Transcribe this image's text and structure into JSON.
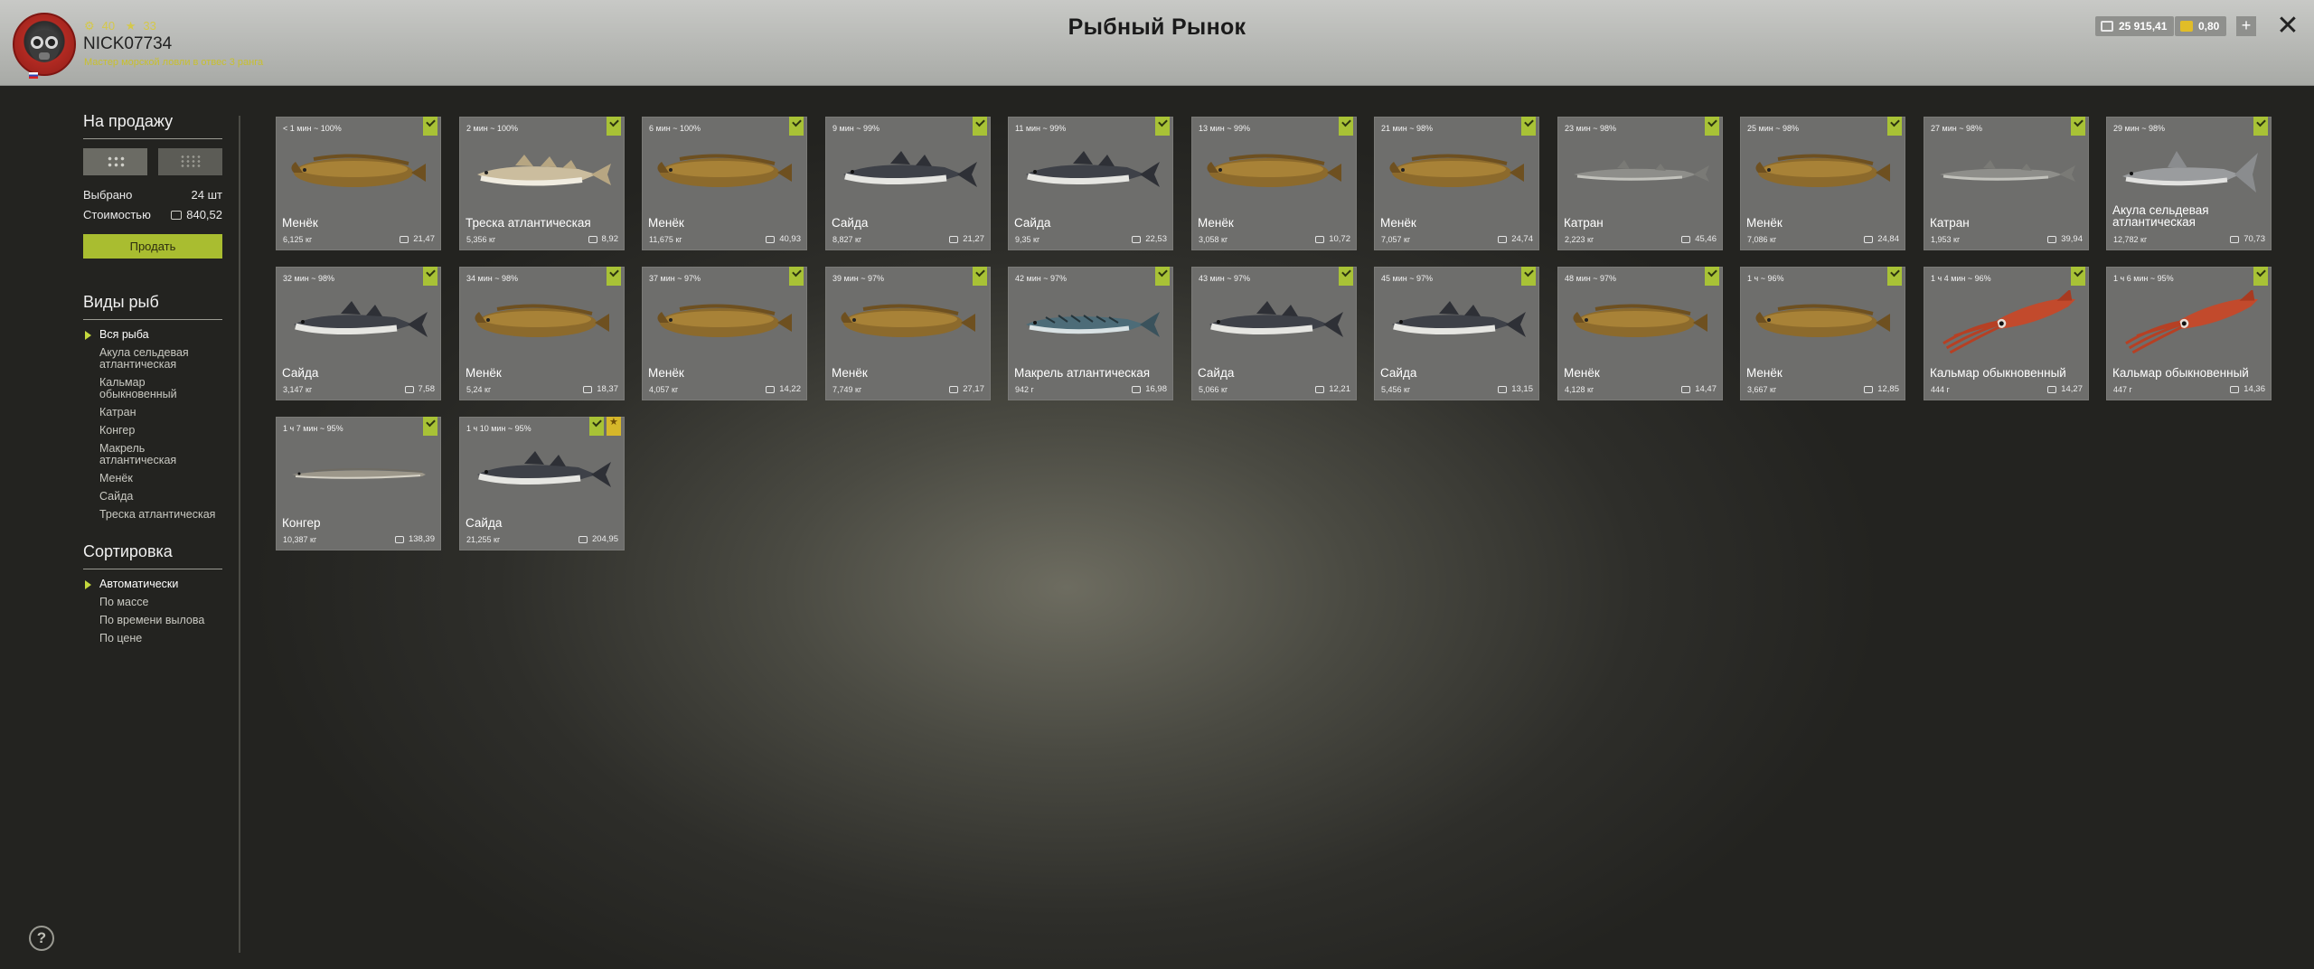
{
  "header": {
    "title": "Рыбный Рынок",
    "player": {
      "name": "NICK07734",
      "stat1": "40",
      "stat2": "33",
      "rank": "Мастер морской ловли в отвес 3 ранга"
    },
    "currency": {
      "silver": "25 915,41",
      "gold": "0,80",
      "add_label": "+"
    },
    "close_label": "✕"
  },
  "sidebar": {
    "for_sale_heading": "На продажу",
    "selected_label": "Выбрано",
    "selected_value": "24 шт",
    "cost_label": "Стоимостью",
    "cost_value": "840,52",
    "sell_button": "Продать",
    "species_heading": "Виды рыб",
    "species": [
      {
        "label": "Вся рыба",
        "active": true
      },
      {
        "label": "Акула сельдевая атлантическая",
        "active": false
      },
      {
        "label": "Кальмар обыкновенный",
        "active": false
      },
      {
        "label": "Катран",
        "active": false
      },
      {
        "label": "Конгер",
        "active": false
      },
      {
        "label": "Макрель атлантическая",
        "active": false
      },
      {
        "label": "Менёк",
        "active": false
      },
      {
        "label": "Сайда",
        "active": false
      },
      {
        "label": "Треска атлантическая",
        "active": false
      }
    ],
    "sort_heading": "Сортировка",
    "sort": [
      {
        "label": "Автоматически",
        "active": true
      },
      {
        "label": "По массе",
        "active": false
      },
      {
        "label": "По времени вылова",
        "active": false
      },
      {
        "label": "По цене",
        "active": false
      }
    ],
    "help_label": "?"
  },
  "colors": {
    "accent": "#a9bd30",
    "card": "#6e6e6c",
    "header": "#b8b9b6"
  },
  "fish": [
    {
      "time": "< 1 мин ~ 100%",
      "name": "Менёк",
      "weight": "6,125 кг",
      "price": "21,47",
      "kind": "menek",
      "star": false
    },
    {
      "time": "2 мин ~ 100%",
      "name": "Треска атлантическая",
      "weight": "5,356 кг",
      "price": "8,92",
      "kind": "cod",
      "star": false
    },
    {
      "time": "6 мин ~ 100%",
      "name": "Менёк",
      "weight": "11,675 кг",
      "price": "40,93",
      "kind": "menek",
      "star": false
    },
    {
      "time": "9 мин ~ 99%",
      "name": "Сайда",
      "weight": "8,827 кг",
      "price": "21,27",
      "kind": "saida",
      "star": false
    },
    {
      "time": "11 мин ~ 99%",
      "name": "Сайда",
      "weight": "9,35 кг",
      "price": "22,53",
      "kind": "saida",
      "star": false
    },
    {
      "time": "13 мин ~ 99%",
      "name": "Менёк",
      "weight": "3,058 кг",
      "price": "10,72",
      "kind": "menek",
      "star": false
    },
    {
      "time": "21 мин ~ 98%",
      "name": "Менёк",
      "weight": "7,057 кг",
      "price": "24,74",
      "kind": "menek",
      "star": false
    },
    {
      "time": "23 мин ~ 98%",
      "name": "Катран",
      "weight": "2,223 кг",
      "price": "45,46",
      "kind": "katran",
      "star": false
    },
    {
      "time": "25 мин ~ 98%",
      "name": "Менёк",
      "weight": "7,086 кг",
      "price": "24,84",
      "kind": "menek",
      "star": false
    },
    {
      "time": "27 мин ~ 98%",
      "name": "Катран",
      "weight": "1,953 кг",
      "price": "39,94",
      "kind": "katran",
      "star": false
    },
    {
      "time": "29 мин ~ 98%",
      "name": "Акула сельдевая атлантическая",
      "weight": "12,782 кг",
      "price": "70,73",
      "kind": "shark",
      "star": false
    },
    {
      "time": "32 мин ~ 98%",
      "name": "Сайда",
      "weight": "3,147 кг",
      "price": "7,58",
      "kind": "saida",
      "star": false
    },
    {
      "time": "34 мин ~ 98%",
      "name": "Менёк",
      "weight": "5,24 кг",
      "price": "18,37",
      "kind": "menek",
      "star": false
    },
    {
      "time": "37 мин ~ 97%",
      "name": "Менёк",
      "weight": "4,057 кг",
      "price": "14,22",
      "kind": "menek",
      "star": false
    },
    {
      "time": "39 мин ~ 97%",
      "name": "Менёк",
      "weight": "7,749 кг",
      "price": "27,17",
      "kind": "menek",
      "star": false
    },
    {
      "time": "42 мин ~ 97%",
      "name": "Макрель атлантическая",
      "weight": "942 г",
      "price": "16,98",
      "kind": "mackerel",
      "star": false
    },
    {
      "time": "43 мин ~ 97%",
      "name": "Сайда",
      "weight": "5,066 кг",
      "price": "12,21",
      "kind": "saida",
      "star": false
    },
    {
      "time": "45 мин ~ 97%",
      "name": "Сайда",
      "weight": "5,456 кг",
      "price": "13,15",
      "kind": "saida",
      "star": false
    },
    {
      "time": "48 мин ~ 97%",
      "name": "Менёк",
      "weight": "4,128 кг",
      "price": "14,47",
      "kind": "menek",
      "star": false
    },
    {
      "time": "1 ч ~ 96%",
      "name": "Менёк",
      "weight": "3,667 кг",
      "price": "12,85",
      "kind": "menek",
      "star": false
    },
    {
      "time": "1 ч 4 мин ~ 96%",
      "name": "Кальмар обыкновенный",
      "weight": "444 г",
      "price": "14,27",
      "kind": "squid",
      "star": false
    },
    {
      "time": "1 ч 6 мин ~ 95%",
      "name": "Кальмар обыкновенный",
      "weight": "447 г",
      "price": "14,36",
      "kind": "squid",
      "star": false
    },
    {
      "time": "1 ч 7 мин ~ 95%",
      "name": "Конгер",
      "weight": "10,387 кг",
      "price": "138,39",
      "kind": "conger",
      "star": false
    },
    {
      "time": "1 ч 10 мин ~ 95%",
      "name": "Сайда",
      "weight": "21,255 кг",
      "price": "204,95",
      "kind": "saida",
      "star": true
    }
  ]
}
